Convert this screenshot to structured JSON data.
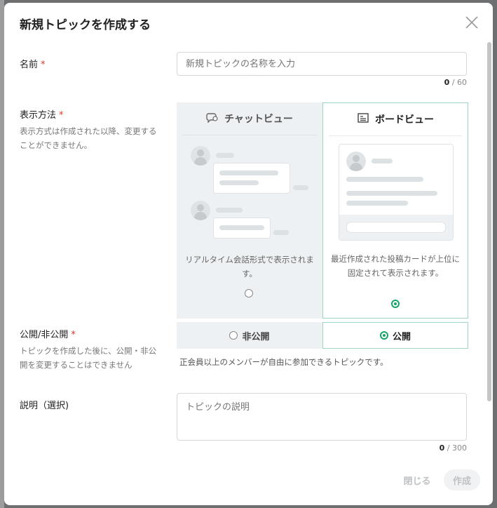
{
  "dialog": {
    "title": "新規トピックを作成する"
  },
  "name_field": {
    "label": "名前",
    "required": "*",
    "placeholder": "新規トピックの名称を入力",
    "count": "0",
    "max": " / 60"
  },
  "display_field": {
    "label": "表示方法",
    "required": "*",
    "sub": "表示方式は作成された以降、変更することができません。",
    "chat": {
      "title": "チャットビュー",
      "icon": "chat-bubble-icon",
      "desc": "リアルタイム会話形式で表示されます。",
      "selected": false
    },
    "board": {
      "title": "ボードビュー",
      "icon": "board-icon",
      "desc": "最近作成された投稿カードが上位に固定されて表示されます。",
      "selected": true
    }
  },
  "visibility_field": {
    "label": "公開/非公開",
    "required": "*",
    "sub": "トピックを作成した後に、公開・非公開を変更することはできません",
    "private_label": "非公開",
    "public_label": "公開",
    "selected": "public",
    "note": "正会員以上のメンバーが自由に参加できるトピックです。"
  },
  "description_field": {
    "label": "説明（選択)",
    "placeholder": "トピックの説明",
    "count": "0",
    "max": " / 300"
  },
  "footer": {
    "close_label": "閉じる",
    "create_label": "作成"
  },
  "colors": {
    "accent": "#1aa568",
    "required": "#e0362c",
    "selected_border": "#9fd6bd"
  }
}
